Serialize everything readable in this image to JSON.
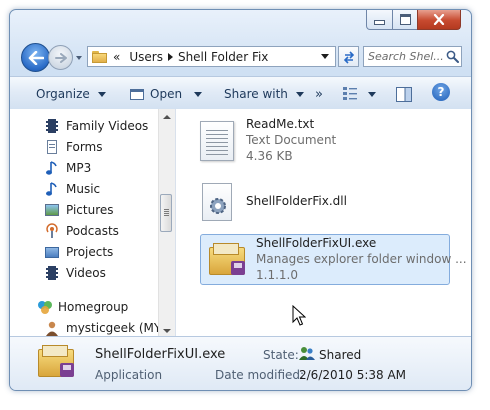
{
  "address": {
    "chevrons": "«",
    "segments": [
      "Users",
      "Shell Folder Fix"
    ]
  },
  "search": {
    "placeholder": "Search Shel..."
  },
  "toolbar": {
    "organize": "Organize",
    "open": "Open",
    "share_with": "Share with",
    "more": "»"
  },
  "nav_items": [
    {
      "label": "Family Videos",
      "icon": "video-icon"
    },
    {
      "label": "Forms",
      "icon": "document-icon"
    },
    {
      "label": "MP3",
      "icon": "music-icon"
    },
    {
      "label": "Music",
      "icon": "music-icon"
    },
    {
      "label": "Pictures",
      "icon": "picture-icon"
    },
    {
      "label": "Podcasts",
      "icon": "podcast-icon"
    },
    {
      "label": "Projects",
      "icon": "folder-icon"
    },
    {
      "label": "Videos",
      "icon": "video-icon"
    }
  ],
  "homegroup": {
    "label": "Homegroup",
    "user": "mysticgeek (MYS"
  },
  "files": [
    {
      "name": "ReadMe.txt",
      "type": "Text Document",
      "size": "4.36 KB"
    },
    {
      "name": "ShellFolderFix.dll"
    },
    {
      "name": "ShellFolderFixUI.exe",
      "description": "Manages explorer folder window ...",
      "version": "1.1.1.0"
    }
  ],
  "details": {
    "name": "ShellFolderFixUI.exe",
    "type": "Application",
    "state_label": "State:",
    "state_value": "Shared",
    "modified_label": "Date modified:",
    "modified_value": "2/6/2010 5:38 AM"
  },
  "colors": {
    "selection": "#cce8ff",
    "accent": "#1e395b"
  }
}
